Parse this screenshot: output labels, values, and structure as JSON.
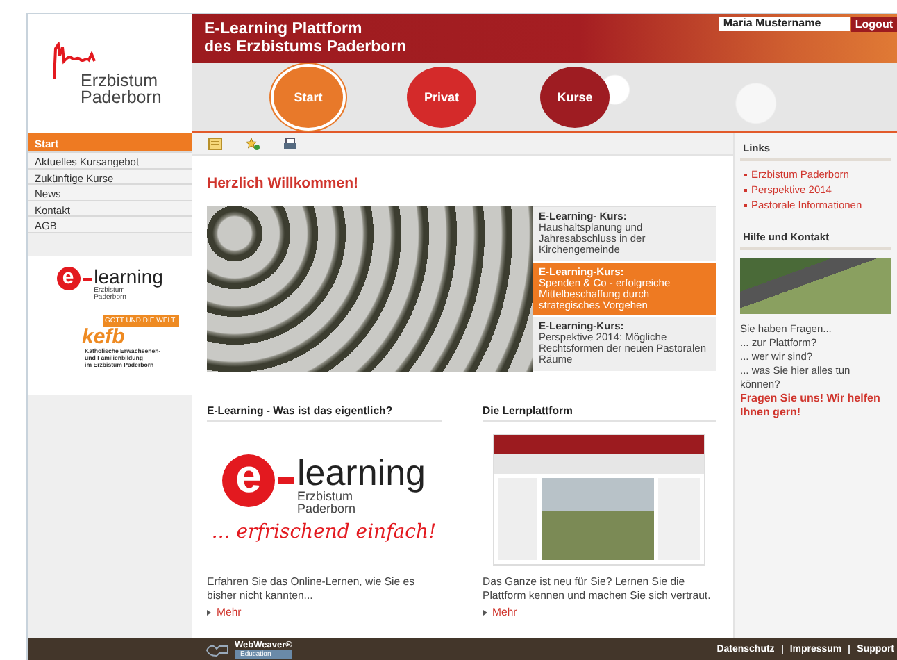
{
  "header": {
    "title_lines": [
      "E-Learning Plattform",
      "des Erzbistums Paderborn"
    ],
    "logo_lines": [
      "Erzbistum",
      "Paderborn"
    ],
    "user_name": "Maria Mustername",
    "logout": "Logout",
    "nav": [
      {
        "label": "Start",
        "color": "#e8792a",
        "selected": true
      },
      {
        "label": "Privat",
        "color": "#d42a2a",
        "selected": false
      },
      {
        "label": "Kurse",
        "color": "#9e1c22",
        "selected": false
      }
    ]
  },
  "sidebar": {
    "items": [
      {
        "label": "Start",
        "selected": true
      },
      {
        "label": "Aktuelles Kursangebot",
        "selected": false
      },
      {
        "label": "Zukünftige Kurse",
        "selected": false
      },
      {
        "label": "News",
        "selected": false
      },
      {
        "label": "Kontakt",
        "selected": false
      },
      {
        "label": "AGB",
        "selected": false
      }
    ],
    "elearning_logo": {
      "letter": "e",
      "word": "learning",
      "lines": [
        "Erzbistum",
        "Paderborn"
      ]
    },
    "kefb_logo": {
      "tagline": "GOTT UND DIE WELT.",
      "name": "kefb",
      "lines": [
        "Katholische Erwachsenen-",
        "und Familienbildung",
        "im Erzbistum Paderborn"
      ]
    }
  },
  "main": {
    "heading": "Herzlich Willkommen!",
    "courses": [
      {
        "title": "E-Learning- Kurs:",
        "text": "Haushaltsplanung und Jahresabschluss in der Kirchengemeinde",
        "selected": false
      },
      {
        "title": "E-Learning-Kurs:",
        "text": "Spenden & Co - erfolgreiche Mittelbeschaffung durch strategisches Vorgehen",
        "selected": true
      },
      {
        "title": "E-Learning-Kurs:",
        "text": "Perspektive 2014: Mögliche Rechtsformen der neuen Pastoralen Räume",
        "selected": false
      }
    ],
    "sections": [
      {
        "kind": "logo",
        "heading": "E-Learning - Was ist das eigentlich?",
        "logo": {
          "letter": "e",
          "word": "learning",
          "lines": [
            "Erzbistum",
            "Paderborn"
          ],
          "slogan": "... erfrischend einfach!"
        },
        "text": "Erfahren Sie das Online-Lernen, wie Sie es bisher nicht kannten...",
        "more": "Mehr"
      },
      {
        "kind": "screenshot",
        "heading": "Die Lernplattform",
        "text": "Das Ganze ist neu für Sie? Lernen Sie die Plattform kennen und machen Sie sich vertraut.",
        "more": "Mehr"
      }
    ]
  },
  "right": {
    "links": {
      "heading": "Links",
      "items": [
        "Erzbistum Paderborn",
        "Perspektive 2014",
        "Pastorale Informationen"
      ]
    },
    "help": {
      "heading": "Hilfe und Kontakt",
      "lines": [
        "Sie haben Fragen...",
        "... zur Plattform?",
        "... wer wir sind?",
        "... was Sie hier alles tun können?"
      ],
      "call_to_action": "Fragen Sie uns! Wir helfen Ihnen gern!"
    }
  },
  "footer": {
    "brand": "WebWeaver®",
    "brand_sub": "Education",
    "links": [
      "Datenschutz",
      "Impressum",
      "Support"
    ]
  }
}
